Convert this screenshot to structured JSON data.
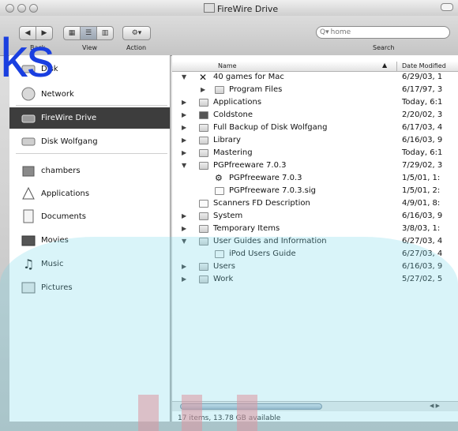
{
  "window": {
    "title": "FireWire Drive",
    "accent": "#3d3d3d"
  },
  "toolbar": {
    "back_label": "Back",
    "view_label": "View",
    "action_label": "Action",
    "search_label": "Search",
    "search_value": "home",
    "search_icon": "magnifier-icon"
  },
  "overlay_text": "ks",
  "sidebar": {
    "items": [
      {
        "label": "Disk",
        "icon": "disk-icon"
      },
      {
        "label": "Network",
        "icon": "globe-icon"
      },
      {
        "label": "FireWire Drive",
        "icon": "drive-icon"
      },
      {
        "label": "Disk Wolfgang",
        "icon": "drive-icon"
      },
      {
        "label": "chambers",
        "icon": "home-icon"
      },
      {
        "label": "Applications",
        "icon": "apps-icon"
      },
      {
        "label": "Documents",
        "icon": "document-icon"
      },
      {
        "label": "Movies",
        "icon": "movie-icon"
      },
      {
        "label": "Music",
        "icon": "music-icon"
      },
      {
        "label": "Pictures",
        "icon": "picture-icon"
      }
    ]
  },
  "list": {
    "columns": {
      "name": "Name",
      "date": "Date Modified"
    },
    "rows": [
      {
        "name": "40 games for Mac",
        "date": "6/29/03, 1"
      },
      {
        "name": "Program Files",
        "date": "6/17/97, 3"
      },
      {
        "name": "Applications",
        "date": "Today, 6:1"
      },
      {
        "name": "Coldstone",
        "date": "2/20/02, 3"
      },
      {
        "name": "Full Backup of Disk Wolfgang",
        "date": "6/17/03, 4"
      },
      {
        "name": "Library",
        "date": "6/16/03, 9"
      },
      {
        "name": "Mastering",
        "date": "Today, 6:1"
      },
      {
        "name": "PGPfreeware 7.0.3",
        "date": "7/29/02, 3"
      },
      {
        "name": "PGPfreeware 7.0.3",
        "date": "1/5/01, 1:"
      },
      {
        "name": "PGPfreeware 7.0.3.sig",
        "date": "1/5/01, 2:"
      },
      {
        "name": "Scanners FD Description",
        "date": "4/9/01, 8:"
      },
      {
        "name": "System",
        "date": "6/16/03, 9"
      },
      {
        "name": "Temporary Items",
        "date": "3/8/03, 1:"
      },
      {
        "name": "User Guides and Information",
        "date": "6/27/03, 4"
      },
      {
        "name": "iPod Users Guide",
        "date": "6/27/03, 4"
      },
      {
        "name": "Users",
        "date": "6/16/03, 9"
      },
      {
        "name": "Work",
        "date": "5/27/02, 5"
      }
    ]
  },
  "status": {
    "text": "17 items, 13.78 GB available"
  }
}
